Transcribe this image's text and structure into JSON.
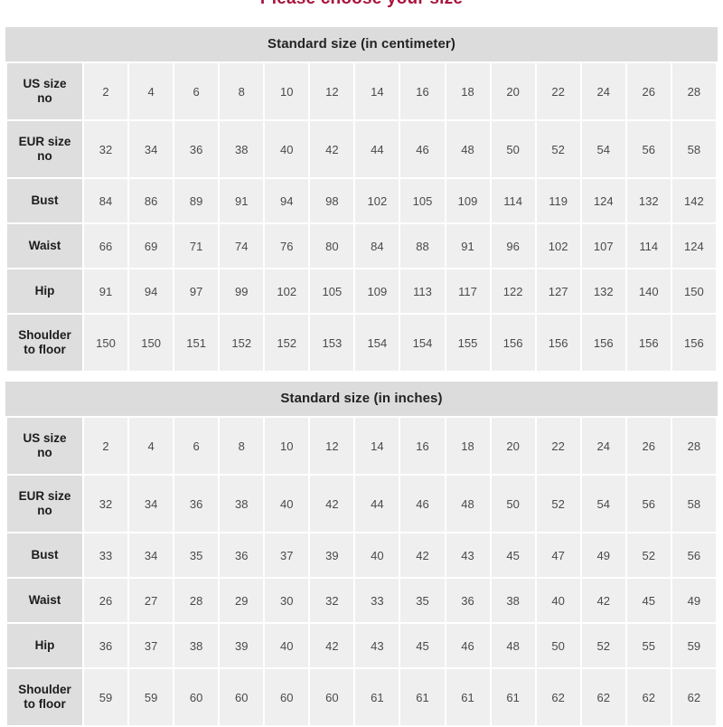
{
  "page": {
    "title": "Please choose your size",
    "title_color": "#a8143c"
  },
  "colors": {
    "caption_bg": "#dcdcdc",
    "rowhead_bg": "#dedede",
    "cell_bg": "#efefef",
    "grid": "#ffffff",
    "text_dark": "#1c1c1c",
    "text_cell": "#4a4a4a"
  },
  "tables": [
    {
      "id": "standard-size-cm",
      "caption": "Standard size (in centimeter)",
      "rows": [
        {
          "label": "US size no",
          "label_lines": [
            "US size",
            "no"
          ],
          "tall": true,
          "values": [
            "2",
            "4",
            "6",
            "8",
            "10",
            "12",
            "14",
            "16",
            "18",
            "20",
            "22",
            "24",
            "26",
            "28"
          ]
        },
        {
          "label": "EUR size no",
          "label_lines": [
            "EUR size",
            "no"
          ],
          "tall": true,
          "values": [
            "32",
            "34",
            "36",
            "38",
            "40",
            "42",
            "44",
            "46",
            "48",
            "50",
            "52",
            "54",
            "56",
            "58"
          ]
        },
        {
          "label": "Bust",
          "label_lines": [
            "Bust"
          ],
          "tall": false,
          "values": [
            "84",
            "86",
            "89",
            "91",
            "94",
            "98",
            "102",
            "105",
            "109",
            "114",
            "119",
            "124",
            "132",
            "142"
          ]
        },
        {
          "label": "Waist",
          "label_lines": [
            "Waist"
          ],
          "tall": false,
          "values": [
            "66",
            "69",
            "71",
            "74",
            "76",
            "80",
            "84",
            "88",
            "91",
            "96",
            "102",
            "107",
            "114",
            "124"
          ]
        },
        {
          "label": "Hip",
          "label_lines": [
            "Hip"
          ],
          "tall": false,
          "values": [
            "91",
            "94",
            "97",
            "99",
            "102",
            "105",
            "109",
            "113",
            "117",
            "122",
            "127",
            "132",
            "140",
            "150"
          ]
        },
        {
          "label": "Shoulder to floor",
          "label_lines": [
            "Shoulder",
            "to floor"
          ],
          "tall": true,
          "values": [
            "150",
            "150",
            "151",
            "152",
            "152",
            "153",
            "154",
            "154",
            "155",
            "156",
            "156",
            "156",
            "156",
            "156"
          ]
        }
      ]
    },
    {
      "id": "standard-size-inches",
      "caption": "Standard size (in inches)",
      "rows": [
        {
          "label": "US size no",
          "label_lines": [
            "US size",
            "no"
          ],
          "tall": true,
          "values": [
            "2",
            "4",
            "6",
            "8",
            "10",
            "12",
            "14",
            "16",
            "18",
            "20",
            "22",
            "24",
            "26",
            "28"
          ]
        },
        {
          "label": "EUR size no",
          "label_lines": [
            "EUR size",
            "no"
          ],
          "tall": true,
          "values": [
            "32",
            "34",
            "36",
            "38",
            "40",
            "42",
            "44",
            "46",
            "48",
            "50",
            "52",
            "54",
            "56",
            "58"
          ]
        },
        {
          "label": "Bust",
          "label_lines": [
            "Bust"
          ],
          "tall": false,
          "values": [
            "33",
            "34",
            "35",
            "36",
            "37",
            "39",
            "40",
            "42",
            "43",
            "45",
            "47",
            "49",
            "52",
            "56"
          ]
        },
        {
          "label": "Waist",
          "label_lines": [
            "Waist"
          ],
          "tall": false,
          "values": [
            "26",
            "27",
            "28",
            "29",
            "30",
            "32",
            "33",
            "35",
            "36",
            "38",
            "40",
            "42",
            "45",
            "49"
          ]
        },
        {
          "label": "Hip",
          "label_lines": [
            "Hip"
          ],
          "tall": false,
          "values": [
            "36",
            "37",
            "38",
            "39",
            "40",
            "42",
            "43",
            "45",
            "46",
            "48",
            "50",
            "52",
            "55",
            "59"
          ]
        },
        {
          "label": "Shoulder to floor",
          "label_lines": [
            "Shoulder",
            "to floor"
          ],
          "tall": true,
          "values": [
            "59",
            "59",
            "60",
            "60",
            "60",
            "60",
            "61",
            "61",
            "61",
            "61",
            "62",
            "62",
            "62",
            "62"
          ]
        }
      ]
    }
  ]
}
